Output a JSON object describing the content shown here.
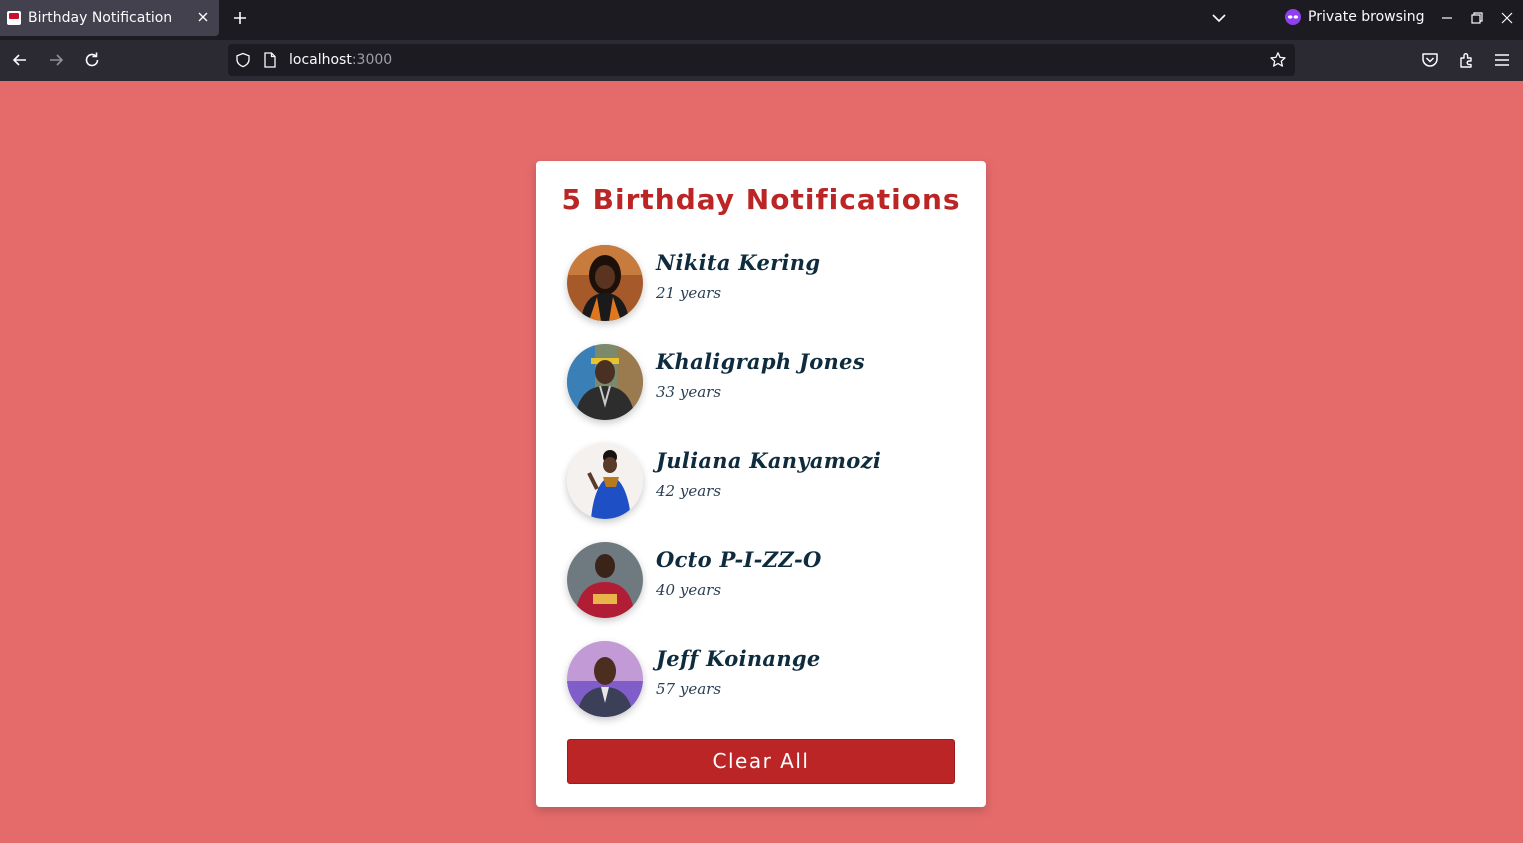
{
  "browser": {
    "tab_title": "Birthday Notification",
    "private_label": "Private browsing",
    "url_host": "localhost",
    "url_port": ":3000",
    "icons": [
      "favicon-icon",
      "close-icon",
      "plus-icon",
      "chevron-down-icon",
      "private-mask-icon",
      "minimize-icon",
      "restore-icon",
      "close-window-icon",
      "back-arrow-icon",
      "forward-arrow-icon",
      "reload-icon",
      "shield-icon",
      "page-icon",
      "star-icon",
      "pocket-icon",
      "extensions-icon",
      "menu-icon"
    ]
  },
  "app": {
    "title": "5 Birthday Notifications",
    "people": [
      {
        "name": "Nikita Kering",
        "age": "21 years"
      },
      {
        "name": "Khaligraph Jones",
        "age": "33 years"
      },
      {
        "name": "Juliana Kanyamozi",
        "age": "42 years"
      },
      {
        "name": "Octo P-I-ZZ-O",
        "age": "40 years"
      },
      {
        "name": "Jeff Koinange",
        "age": "57 years"
      }
    ],
    "clear_label": "Clear All"
  },
  "colors": {
    "background": "#e56b6b",
    "accent": "#bb2525",
    "card": "#ffffff",
    "name_text": "#0f2b3e"
  }
}
